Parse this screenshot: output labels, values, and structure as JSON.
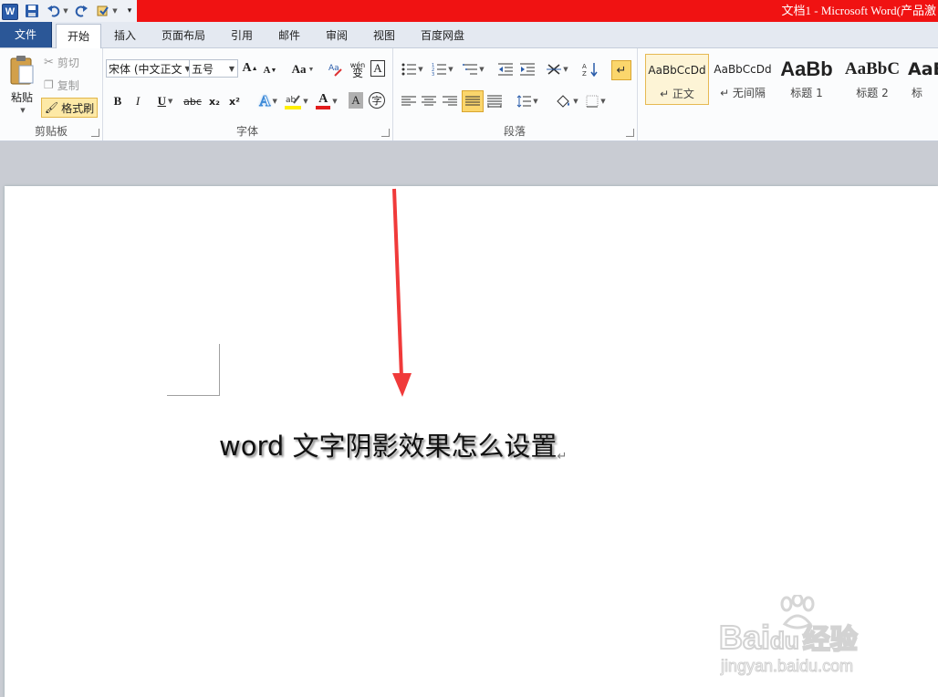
{
  "titlebar": {
    "title": "文档1 - Microsoft Word(产品激",
    "colors": {
      "bar": "#f01212",
      "file_tab": "#2b5797"
    },
    "quick_access": [
      "word-logo-icon",
      "save-icon",
      "undo-icon",
      "redo-icon",
      "format-icon",
      "customize-icon"
    ]
  },
  "tabs": [
    {
      "label": "文件"
    },
    {
      "label": "开始"
    },
    {
      "label": "插入"
    },
    {
      "label": "页面布局"
    },
    {
      "label": "引用"
    },
    {
      "label": "邮件"
    },
    {
      "label": "审阅"
    },
    {
      "label": "视图"
    },
    {
      "label": "百度网盘"
    }
  ],
  "ribbon": {
    "clipboard": {
      "label": "剪贴板",
      "paste": "粘贴",
      "cut": "剪切",
      "copy": "复制",
      "format_painter": "格式刷"
    },
    "font": {
      "label": "字体",
      "font_name": "宋体 (中文正文",
      "font_size": "五号",
      "grow": "A",
      "shrink": "A",
      "change_case": "Aa",
      "bold": "B",
      "italic": "I",
      "underline": "U",
      "strikethrough": "abc",
      "subscript": "x₂",
      "superscript": "x²",
      "font_color_letter": "A",
      "shading_letter": "A",
      "enclose_char": "字",
      "phonetic": "wén",
      "phonetic_letter": "变"
    },
    "paragraph": {
      "label": "段落"
    },
    "styles": {
      "items": [
        {
          "sample": "AaBbCcDd",
          "name": "↵ 正文"
        },
        {
          "sample": "AaBbCcDd",
          "name": "↵ 无间隔"
        },
        {
          "sample": "AaBb",
          "name": "标题 1"
        },
        {
          "sample": "AaBbC",
          "name": "标题 2"
        },
        {
          "sample": "AaB",
          "name": "标"
        }
      ]
    }
  },
  "document": {
    "text": "word 文字阴影效果怎么设置",
    "paragraph_mark": "↵"
  },
  "annotation": {
    "arrow_color": "#f03a3a"
  },
  "watermark": {
    "brand": "Bai",
    "brand2": "du",
    "cn": "经验",
    "url": "jingyan.baidu.com"
  }
}
